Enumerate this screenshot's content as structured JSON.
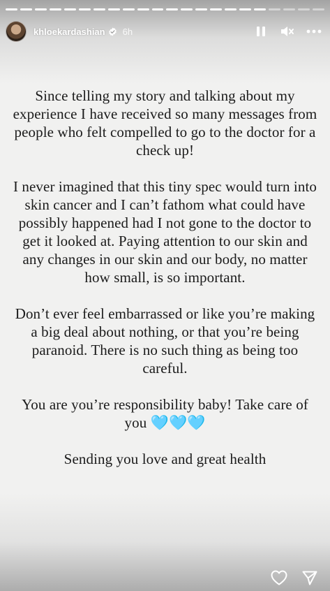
{
  "story": {
    "username": "khloekardashian",
    "time_ago": "6h",
    "progress_segments_total": 22,
    "progress_segments_done": 18
  },
  "content": {
    "paragraphs": [
      "Since telling my story and talking about my experience I have received so many messages from people who felt compelled to go to the doctor for a check up!",
      "I never imagined that this tiny spec would turn into skin cancer and I can’t fathom what could have possibly happened had I not gone to the doctor to get it looked at. Paying attention to our skin and any changes in our skin and our body, no matter how small, is so important.",
      "Don’t ever feel embarrassed or like you’re making a big deal about nothing, or that you’re being paranoid. There is no such thing as being too careful.",
      "You are you’re responsibility baby! Take care of you 🩵🩵🩵",
      "Sending you love and great health"
    ]
  },
  "icons": {
    "verified": "verified-badge-icon",
    "pause": "pause-icon",
    "mute": "mute-icon",
    "more": "more-options-icon",
    "like": "heart-icon",
    "share": "send-icon"
  },
  "colors": {
    "background": "#f1f1f0",
    "text": "#1b1b1b",
    "heart_emoji": "#7fd3ea"
  }
}
